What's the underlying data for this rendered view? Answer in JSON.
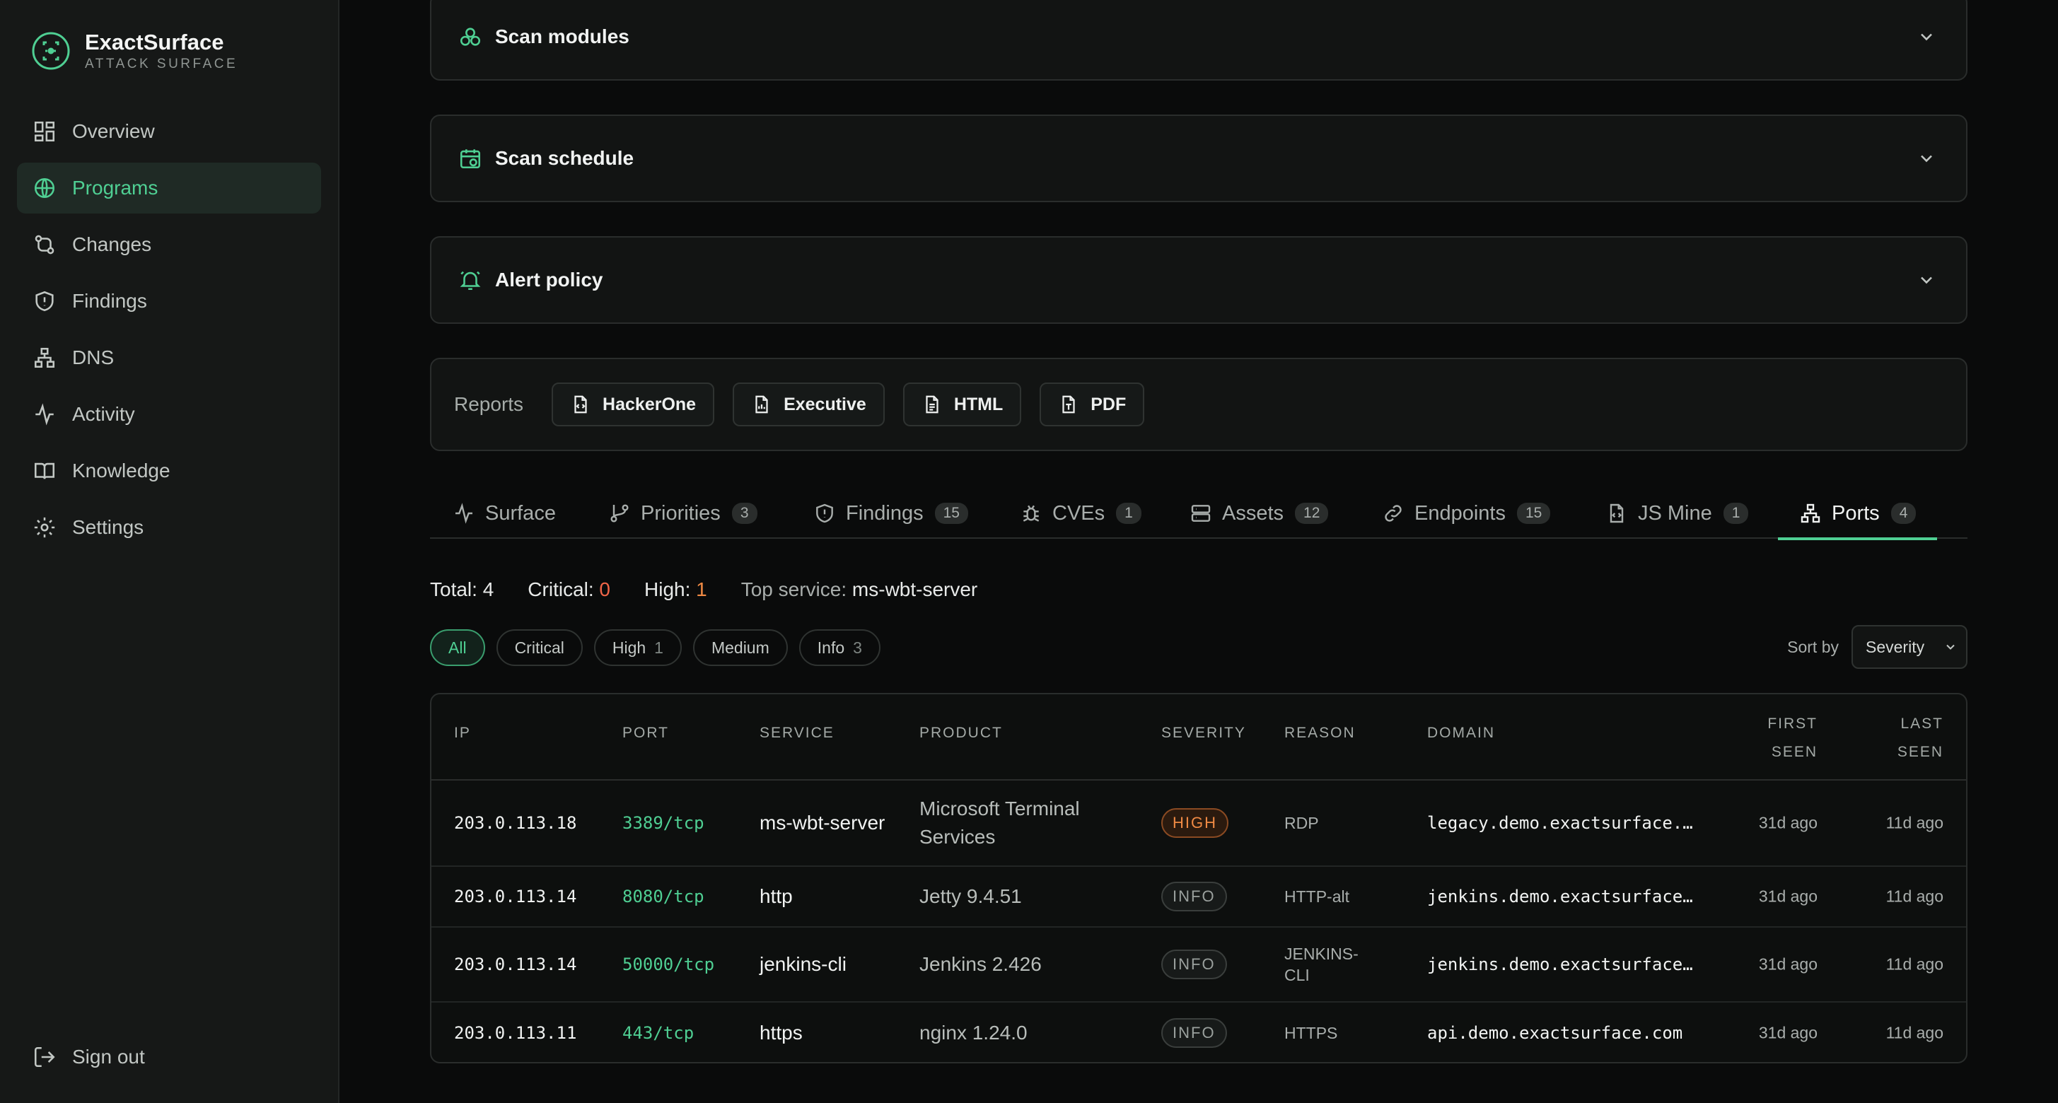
{
  "app": {
    "name": "ExactSurface",
    "subtitle": "ATTACK SURFACE"
  },
  "sidebar": {
    "items": [
      {
        "label": "Overview",
        "icon": "grid-icon",
        "active": false
      },
      {
        "label": "Programs",
        "icon": "globe-icon",
        "active": true
      },
      {
        "label": "Changes",
        "icon": "git-compare-icon",
        "active": false
      },
      {
        "label": "Findings",
        "icon": "shield-icon",
        "active": false
      },
      {
        "label": "DNS",
        "icon": "network-icon",
        "active": false
      },
      {
        "label": "Activity",
        "icon": "activity-icon",
        "active": false
      },
      {
        "label": "Knowledge",
        "icon": "book-icon",
        "active": false
      },
      {
        "label": "Settings",
        "icon": "gear-icon",
        "active": false
      }
    ],
    "signout": "Sign out"
  },
  "sections": {
    "scan_modules": "Scan modules",
    "scan_schedule": "Scan schedule",
    "alert_policy": "Alert policy"
  },
  "reports": {
    "label": "Reports",
    "buttons": [
      "HackerOne",
      "Executive",
      "HTML",
      "PDF"
    ]
  },
  "tabs": [
    {
      "label": "Surface",
      "count": null,
      "icon": "activity-icon"
    },
    {
      "label": "Priorities",
      "count": "3",
      "icon": "git-branch-icon"
    },
    {
      "label": "Findings",
      "count": "15",
      "icon": "shield-icon"
    },
    {
      "label": "CVEs",
      "count": "1",
      "icon": "bug-icon"
    },
    {
      "label": "Assets",
      "count": "12",
      "icon": "server-icon"
    },
    {
      "label": "Endpoints",
      "count": "15",
      "icon": "link-icon"
    },
    {
      "label": "JS Mine",
      "count": "1",
      "icon": "file-code-icon"
    },
    {
      "label": "Ports",
      "count": "4",
      "icon": "network-icon",
      "active": true
    }
  ],
  "summary": {
    "total_label": "Total:",
    "total": "4",
    "critical_label": "Critical:",
    "critical": "0",
    "high_label": "High:",
    "high": "1",
    "top_label": "Top service:",
    "top": "ms-wbt-server"
  },
  "filters": [
    {
      "label": "All",
      "count": null,
      "active": true
    },
    {
      "label": "Critical",
      "count": null
    },
    {
      "label": "High",
      "count": "1"
    },
    {
      "label": "Medium",
      "count": null
    },
    {
      "label": "Info",
      "count": "3"
    }
  ],
  "sort": {
    "label": "Sort by",
    "value": "Severity"
  },
  "table": {
    "headers": {
      "ip": "IP",
      "port": "PORT",
      "service": "SERVICE",
      "product": "PRODUCT",
      "severity": "SEVERITY",
      "reason": "REASON",
      "domain": "DOMAIN",
      "first_seen": "FIRST SEEN",
      "last_seen": "LAST SEEN"
    },
    "rows": [
      {
        "ip": "203.0.113.18",
        "port": "3389/tcp",
        "service": "ms-wbt-server",
        "product": "Microsoft Terminal Services",
        "severity": "HIGH",
        "reason": "RDP",
        "domain": "legacy.demo.exactsurface.…",
        "first_seen": "31d ago",
        "last_seen": "11d ago"
      },
      {
        "ip": "203.0.113.14",
        "port": "8080/tcp",
        "service": "http",
        "product": "Jetty 9.4.51",
        "severity": "INFO",
        "reason": "HTTP-alt",
        "domain": "jenkins.demo.exactsurface…",
        "first_seen": "31d ago",
        "last_seen": "11d ago"
      },
      {
        "ip": "203.0.113.14",
        "port": "50000/tcp",
        "service": "jenkins-cli",
        "product": "Jenkins 2.426",
        "severity": "INFO",
        "reason": "JENKINS-CLI",
        "domain": "jenkins.demo.exactsurface…",
        "first_seen": "31d ago",
        "last_seen": "11d ago"
      },
      {
        "ip": "203.0.113.11",
        "port": "443/tcp",
        "service": "https",
        "product": "nginx 1.24.0",
        "severity": "INFO",
        "reason": "HTTPS",
        "domain": "api.demo.exactsurface.com",
        "first_seen": "31d ago",
        "last_seen": "11d ago"
      }
    ]
  },
  "colors": {
    "accent": "#4fcf93",
    "critical": "#f06548",
    "high": "#f08a44"
  }
}
